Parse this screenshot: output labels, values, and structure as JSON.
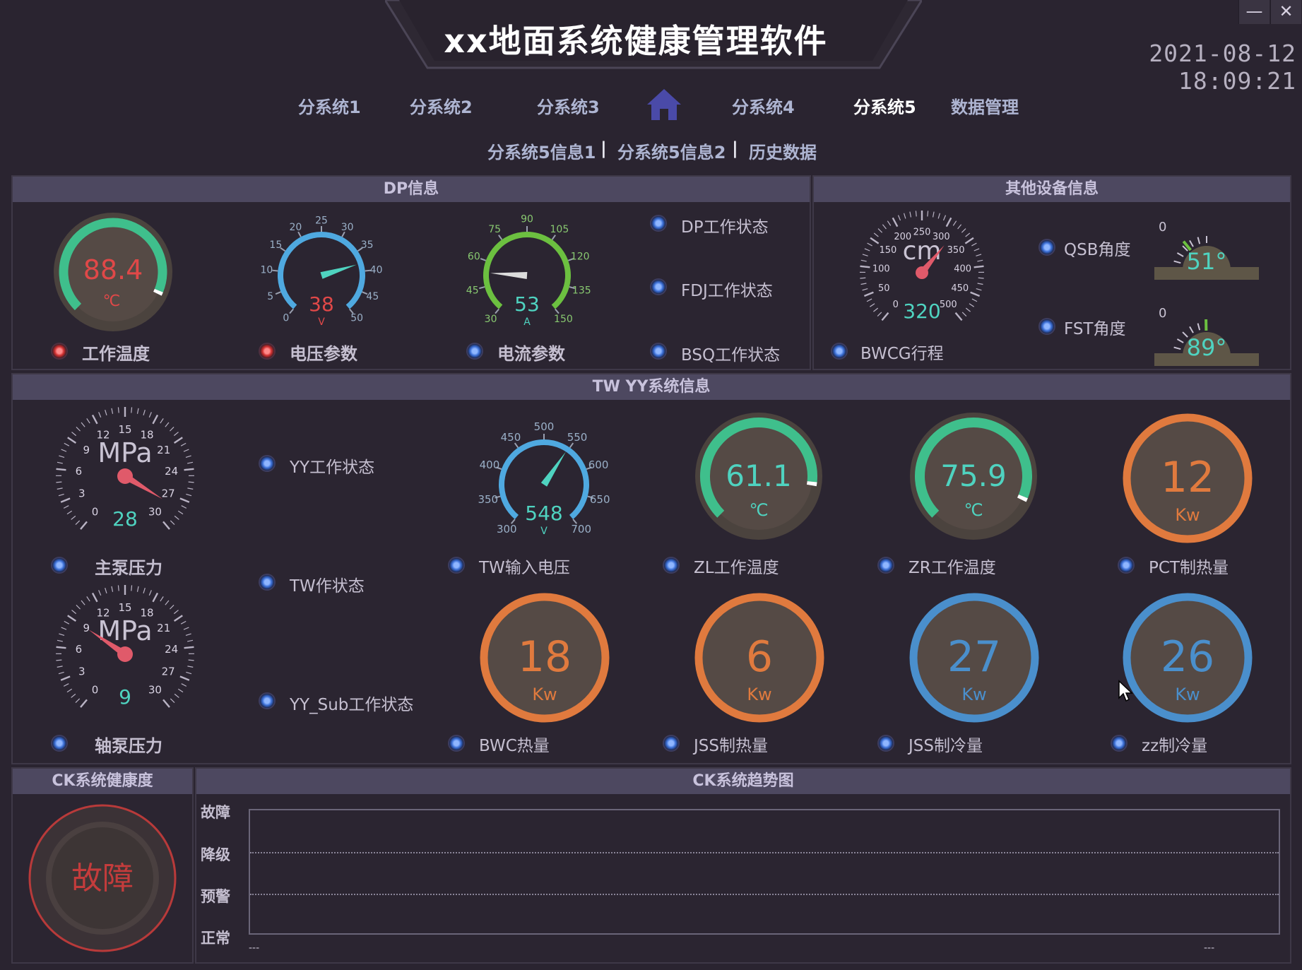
{
  "header": {
    "title": "xx地面系统健康管理软件",
    "datetime": "2021-08-12  18:09:21",
    "minimize": "—",
    "close": "✕"
  },
  "nav": {
    "items": [
      "分系统1",
      "分系统2",
      "分系统3",
      "分系统4",
      "分系统5",
      "数据管理"
    ],
    "active": "分系统5",
    "sub": [
      "分系统5信息1",
      "分系统5信息2",
      "历史数据"
    ],
    "separator": "|"
  },
  "dp": {
    "title": "DP信息",
    "temp": {
      "value": "88.4",
      "unit": "℃",
      "label": "工作温度",
      "fraction": 0.93
    },
    "voltage": {
      "value": "38",
      "unit": "V",
      "label": "电压参数",
      "ticks": [
        "0",
        "5",
        "10",
        "15",
        "20",
        "25",
        "30",
        "35",
        "40",
        "45",
        "50"
      ],
      "min": 0,
      "max": 50
    },
    "current": {
      "value": "53",
      "unit": "A",
      "label": "电流参数",
      "ticks": [
        "30",
        "45",
        "60",
        "75",
        "90",
        "105",
        "120",
        "135",
        "150"
      ],
      "min": 30,
      "max": 150
    },
    "status": [
      "DP工作状态",
      "FDJ工作状态",
      "BSQ工作状态"
    ]
  },
  "other": {
    "title": "其他设备信息",
    "bwcg": {
      "value": "320",
      "unit": "cm",
      "label": "BWCG行程",
      "ticks": [
        "0",
        "50",
        "100",
        "150",
        "200",
        "250",
        "300",
        "350",
        "400",
        "450",
        "500"
      ],
      "min": 0,
      "max": 500
    },
    "qsb": {
      "label": "QSB角度",
      "value": "51°",
      "zero": "0",
      "angle": 51
    },
    "fst": {
      "label": "FST角度",
      "value": "89°",
      "zero": "0",
      "angle": 89
    }
  },
  "tw": {
    "title": "TW YY系统信息",
    "main_pump": {
      "value": "28",
      "unit": "MPa",
      "label": "主泵压力",
      "ticks": [
        "0",
        "3",
        "6",
        "9",
        "12",
        "15",
        "18",
        "21",
        "24",
        "27",
        "30"
      ],
      "min": 0,
      "max": 30
    },
    "shaft_pump": {
      "value": "9",
      "unit": "MPa",
      "label": "轴泵压力",
      "ticks": [
        "0",
        "3",
        "6",
        "9",
        "12",
        "15",
        "18",
        "21",
        "24",
        "27",
        "30"
      ],
      "min": 0,
      "max": 30
    },
    "status": [
      "YY工作状态",
      "TW作状态",
      "YY_Sub工作状态"
    ],
    "tw_voltage": {
      "value": "548",
      "unit": "V",
      "label": "TW输入电压",
      "ticks": [
        "300",
        "350",
        "400",
        "450",
        "500",
        "550",
        "600",
        "650",
        "700"
      ],
      "min": 300,
      "max": 700
    },
    "zl_temp": {
      "value": "61.1",
      "unit": "℃",
      "label": "ZL工作温度",
      "fraction": 0.87
    },
    "zr_temp": {
      "value": "75.9",
      "unit": "℃",
      "label": "ZR工作温度",
      "fraction": 0.93
    },
    "pct": {
      "value": "12",
      "unit": "Kw",
      "label": "PCT制热量",
      "color": "#e07a3e"
    },
    "bwc": {
      "value": "18",
      "unit": "Kw",
      "label": "BWC热量",
      "color": "#e07a3e"
    },
    "jss_heat": {
      "value": "6",
      "unit": "Kw",
      "label": "JSS制热量",
      "color": "#e07a3e"
    },
    "jss_cool": {
      "value": "27",
      "unit": "Kw",
      "label": "JSS制冷量",
      "color": "#4a8fcc"
    },
    "zz_cool": {
      "value": "26",
      "unit": "Kw",
      "label": "zz制冷量",
      "color": "#4a8fcc"
    }
  },
  "ck": {
    "health_title": "CK系统健康度",
    "health_state": "故障",
    "trend_title": "CK系统趋势图",
    "levels": [
      "故障",
      "降级",
      "预警",
      "正常"
    ],
    "x_left": "---",
    "x_right": "---"
  },
  "colors": {
    "green": "#3fbf8c",
    "orange": "#e07a3e",
    "blue": "#4a8fcc",
    "red": "#e04848",
    "teal": "#4fd3c0"
  },
  "icons": {
    "home": "home-icon",
    "led": "status-led-icon"
  }
}
